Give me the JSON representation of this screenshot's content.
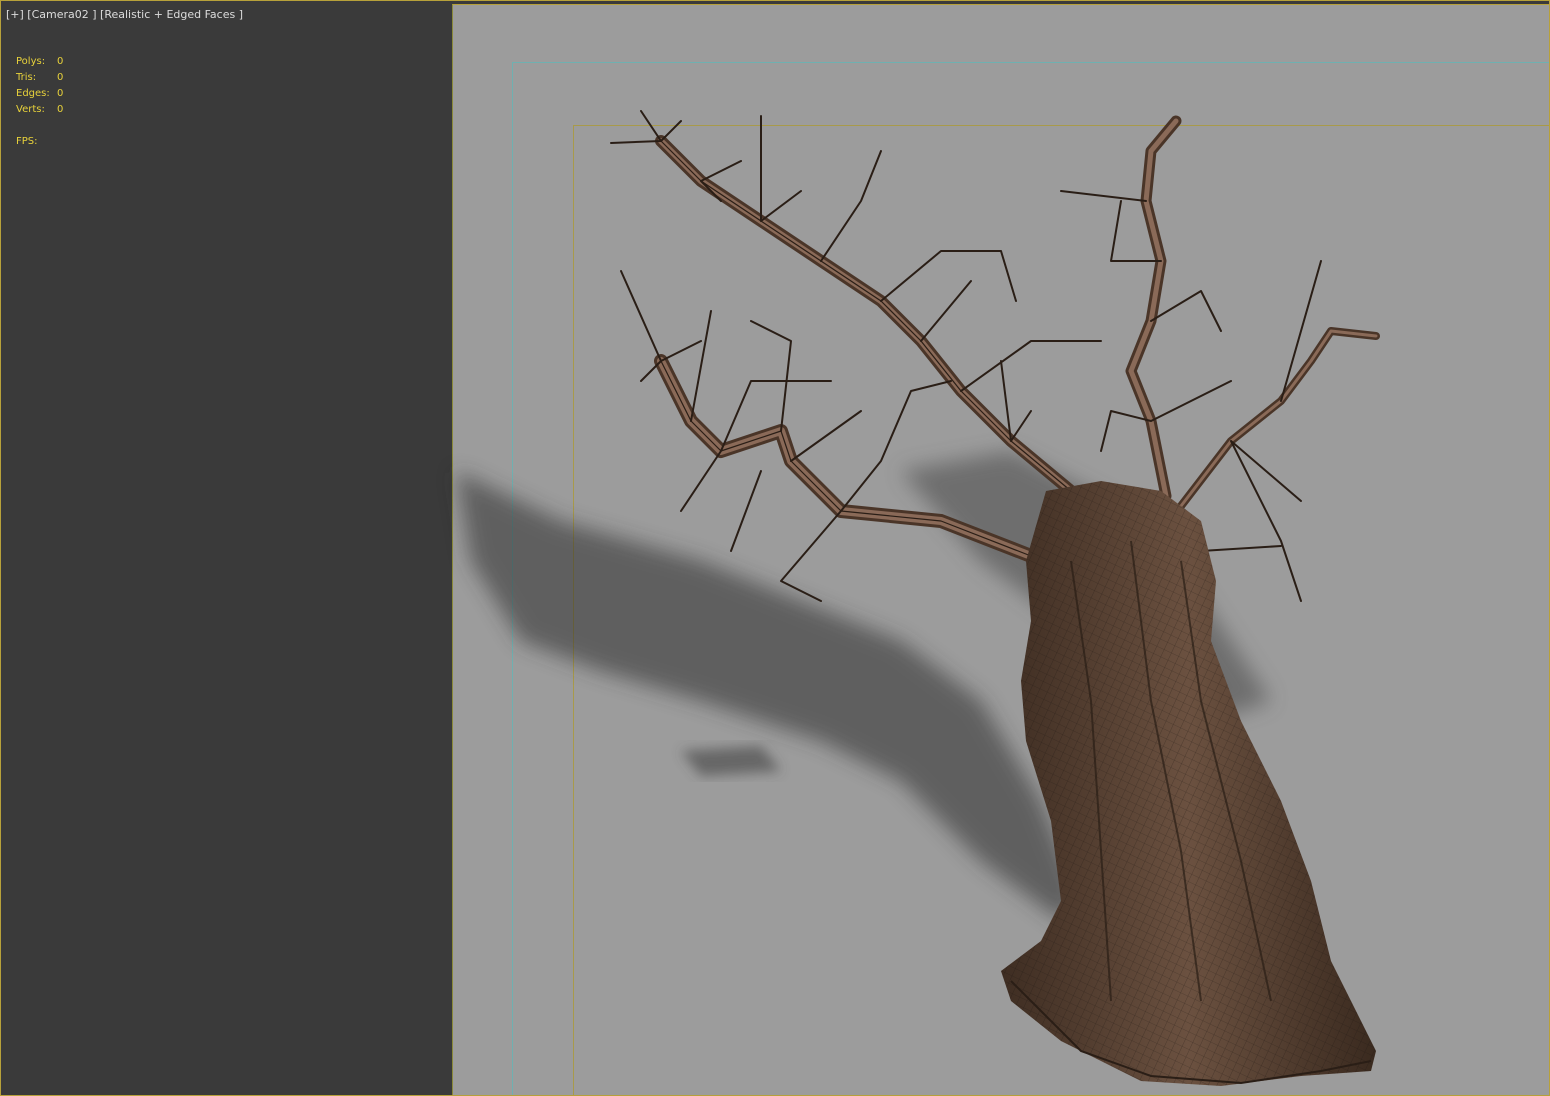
{
  "viewport": {
    "label": "[+] [Camera02 ] [Realistic + Edged Faces ]"
  },
  "stats": {
    "polys_label": "Polys:",
    "polys_value": "0",
    "tris_label": "Tris:",
    "tris_value": "0",
    "edges_label": "Edges:",
    "edges_value": "0",
    "verts_label": "Verts:",
    "verts_value": "0",
    "fps_label": "FPS:",
    "fps_value": ""
  },
  "colors": {
    "stats_text": "#e8d23a",
    "viewport_border": "#b7a13a",
    "background_dark": "#3a3a3a",
    "render_background": "#9c9c9c",
    "safe_frame_outer": "#6fb0b0",
    "safe_frame_inner": "#a89a4a",
    "tree_bark": "#5a4433",
    "tree_wire": "#1a1410"
  },
  "scene": {
    "object": "dead-tree-model"
  }
}
